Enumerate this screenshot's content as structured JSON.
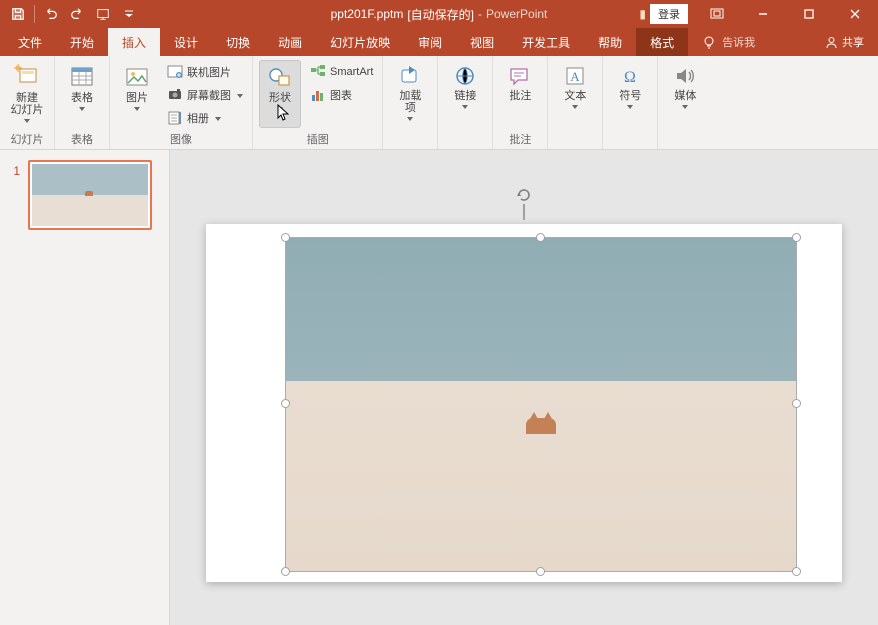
{
  "title": {
    "filename": "ppt201F.pptm",
    "auto": "[自动保存的]",
    "dash": " - ",
    "app": "PowerPoint"
  },
  "win": {
    "login": "登录"
  },
  "tabs": {
    "file": "文件",
    "home": "开始",
    "insert": "插入",
    "design": "设计",
    "transition": "切换",
    "animation": "动画",
    "slideshow": "幻灯片放映",
    "review": "审阅",
    "view": "视图",
    "developer": "开发工具",
    "help": "帮助",
    "format": "格式",
    "tell": "告诉我",
    "share": "共享"
  },
  "ribbon": {
    "slides": {
      "label": "幻灯片",
      "new": "新建\n幻灯片"
    },
    "tables": {
      "label": "表格",
      "btn": "表格"
    },
    "images": {
      "label": "图像",
      "btn": "图片",
      "online": "联机图片",
      "screenshot": "屏幕截图",
      "album": "相册"
    },
    "illustrations": {
      "label": "插图",
      "shapes": "形状",
      "smartart": "SmartArt",
      "chart": "图表"
    },
    "addins": {
      "label": "",
      "btn": "加载\n项"
    },
    "links": {
      "label": "",
      "btn": "链接"
    },
    "comments": {
      "label": "批注",
      "btn": "批注"
    },
    "text": {
      "label": "",
      "btn": "文本"
    },
    "symbols": {
      "label": "",
      "btn": "符号"
    },
    "media": {
      "label": "",
      "btn": "媒体"
    }
  },
  "thumbs": {
    "num1": "1"
  }
}
